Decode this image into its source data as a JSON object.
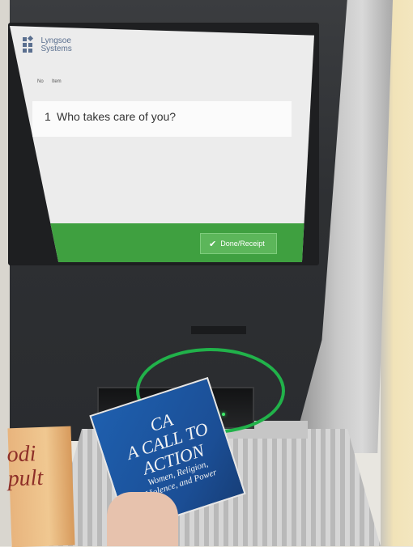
{
  "logo": {
    "line1": "Lyngsoe",
    "line2": "Systems",
    "accent_color": "#5a6f8f"
  },
  "table": {
    "col_no": "No",
    "col_item": "Item",
    "rows": [
      {
        "no": "1",
        "title": "Who takes care of you?"
      }
    ]
  },
  "action_bar": {
    "done_label": "Done/Receipt",
    "check_icon": "check-icon",
    "bar_color": "#3fa040",
    "button_color": "#5cb65a"
  },
  "books": {
    "left_cover_text": "odi\npult",
    "blue_cover_line1": "CA",
    "blue_cover_line2": "A CALL TO",
    "blue_cover_line3": "ACTION",
    "blue_cover_line4": "Women, Religion,",
    "blue_cover_line5": "Violence, and Power"
  },
  "highlight_color": "#21b24a"
}
